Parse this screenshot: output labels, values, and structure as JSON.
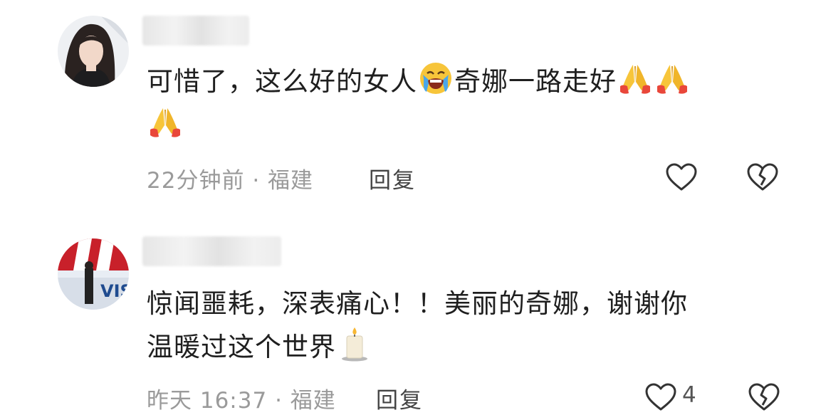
{
  "comments": [
    {
      "text_line1_part1": "可惜了，这么好的女人",
      "emoji_1": "loudly-crying-face-icon",
      "text_line1_part2": "奇娜一路走好",
      "emoji_2": "folded-hands-icon",
      "emoji_3": "folded-hands-icon",
      "emoji_4": "folded-hands-icon",
      "time": "22分钟前",
      "separator": "·",
      "location": "福建",
      "reply_label": "回复",
      "like_icon": "heart-outline-icon",
      "dislike_icon": "broken-heart-icon"
    },
    {
      "text_line1": "惊闻噩耗，深表痛心！！美丽的奇娜，谢谢你",
      "text_line2": "温暖过这个世界",
      "emoji_1": "candle-icon",
      "time": "昨天 16:37",
      "separator": "·",
      "location": "福建",
      "reply_label": "回复",
      "like_icon": "heart-outline-icon",
      "like_count": "4",
      "dislike_icon": "broken-heart-icon"
    }
  ],
  "colors": {
    "text": "#1f1f1f",
    "meta": "#9a9a9a",
    "icon": "#333333",
    "emoji_yellow": "#f7c53a",
    "background": "#ffffff"
  }
}
